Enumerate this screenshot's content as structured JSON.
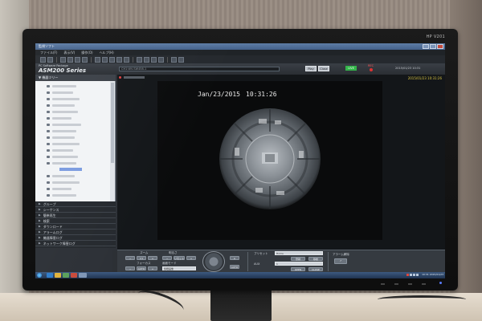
{
  "monitor": {
    "brand": "HP V201"
  },
  "window": {
    "title": "監視ソフト"
  },
  "menu": [
    "ファイル(F)",
    "表示(V)",
    "操作(O)",
    "ヘルプ(H)"
  ],
  "app": {
    "package": "PC Software Package",
    "series": "ASM200 Series",
    "camera_field": "CH1:WV-SW458-1",
    "buttons": {
      "play": "Play",
      "close": "Close",
      "live": "LIVE"
    },
    "rec_label": "REC",
    "header_time": "2015/01/23 10:31"
  },
  "tree": {
    "title": "機器ツリー"
  },
  "sections": [
    "グループ",
    "シーケンス",
    "簡単再生",
    "検索",
    "ダウンロード",
    "アラームログ",
    "機器障害ログ",
    "ネットワーク障害ログ"
  ],
  "video": {
    "osd_date": "Jan/23/2015",
    "osd_time": "10:31:26",
    "stamp": "2015/01/23 10:31:26"
  },
  "controls": {
    "zoom_label": "ズーム",
    "focus_label": "フォーカス",
    "iris_label": "明るさ",
    "mode_label": "画面モード",
    "mode_value": "魚眼画像",
    "preset_label": "プリセット",
    "preset_value": "Home",
    "aux_label": "AUX",
    "aux_value": "1",
    "alarm_label": "アラーム解除",
    "open": "OPEN",
    "close": "CLOSE",
    "register": "登録",
    "move": "移動",
    "auto": "AUTO",
    "reset": "リセット"
  },
  "taskbar": {
    "clock": "10:31 2015/01/23"
  },
  "colors": {
    "live": "#33b44a",
    "rec": "#d33333",
    "selection": "#7c9ce0",
    "titlebar": "#44618a"
  }
}
